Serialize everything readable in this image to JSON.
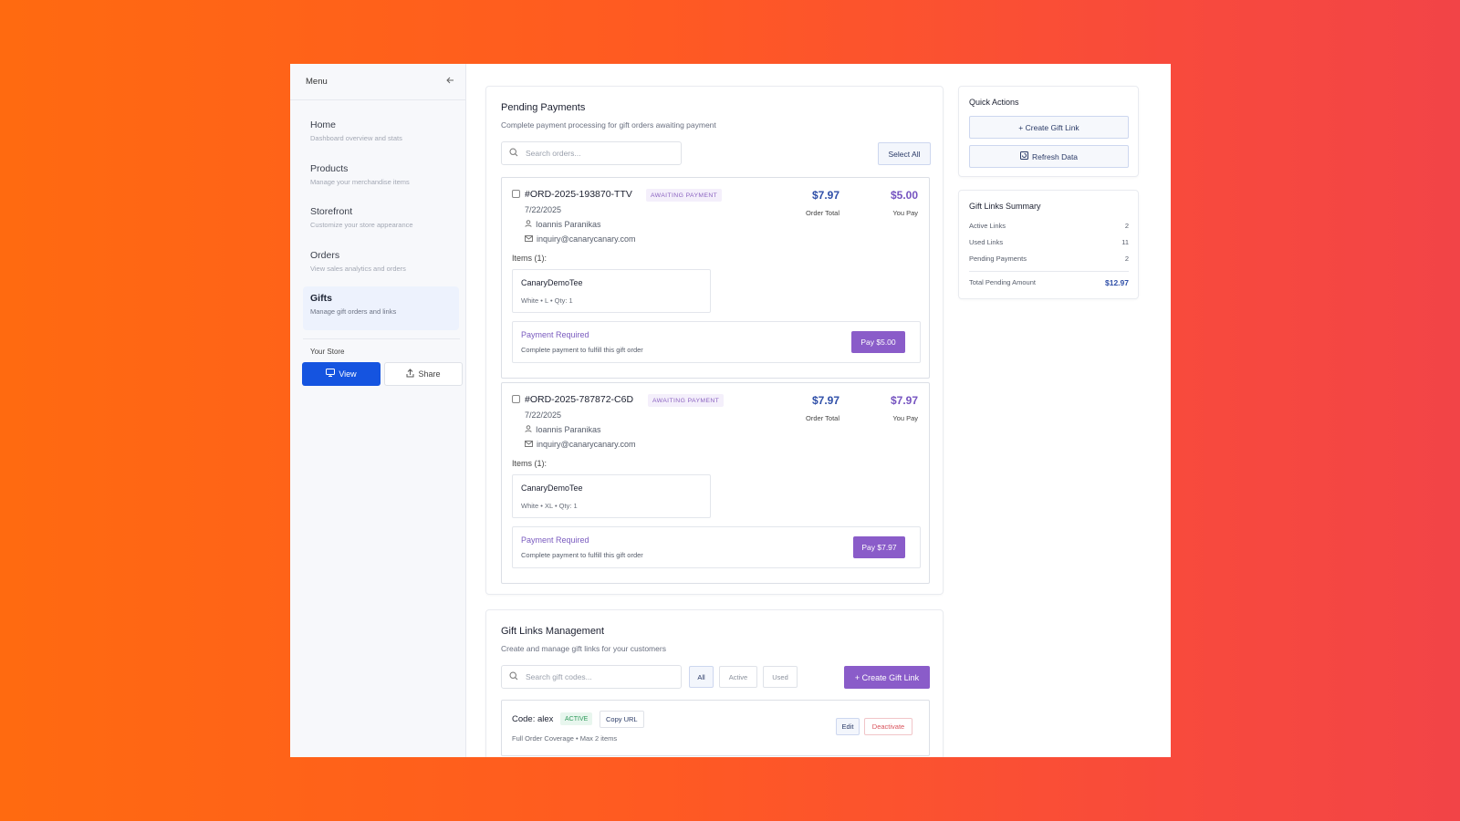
{
  "sidebar": {
    "title": "Menu",
    "items": [
      {
        "label": "Home",
        "desc": "Dashboard overview and stats"
      },
      {
        "label": "Products",
        "desc": "Manage your merchandise items"
      },
      {
        "label": "Storefront",
        "desc": "Customize your store appearance"
      },
      {
        "label": "Orders",
        "desc": "View sales analytics and orders"
      },
      {
        "label": "Gifts",
        "desc": "Manage gift orders and links"
      }
    ],
    "active_item": "Gifts",
    "store_label": "Your Store",
    "view_label": "View",
    "share_label": "Share"
  },
  "pending": {
    "title": "Pending Payments",
    "subtitle": "Complete payment processing for gift orders awaiting payment",
    "search_placeholder": "Search orders...",
    "select_all_label": "Select All",
    "orders": [
      {
        "id": "#ORD-2025-193870-TTV",
        "status": "AWAITING PAYMENT",
        "date": "7/22/2025",
        "customer": "Ioannis Paranikas",
        "email": "inquiry@canarycanary.com",
        "order_total": "$7.97",
        "order_total_label": "Order Total",
        "you_pay": "$5.00",
        "you_pay_label": "You Pay",
        "items_label": "Items (1):",
        "item_name": "CanaryDemoTee",
        "item_variant": "White • L • Qty: 1",
        "payment_title": "Payment Required",
        "payment_sub": "Complete payment to fulfill this gift order",
        "pay_button": "Pay $5.00"
      },
      {
        "id": "#ORD-2025-787872-C6D",
        "status": "AWAITING PAYMENT",
        "date": "7/22/2025",
        "customer": "Ioannis Paranikas",
        "email": "inquiry@canarycanary.com",
        "order_total": "$7.97",
        "order_total_label": "Order Total",
        "you_pay": "$7.97",
        "you_pay_label": "You Pay",
        "items_label": "Items (1):",
        "item_name": "CanaryDemoTee",
        "item_variant": "White • XL • Qty: 1",
        "payment_title": "Payment Required",
        "payment_sub": "Complete payment to fulfill this gift order",
        "pay_button": "Pay $7.97"
      }
    ]
  },
  "gift_links": {
    "title": "Gift Links Management",
    "subtitle": "Create and manage gift links for your customers",
    "search_placeholder": "Search gift codes...",
    "filters": [
      "All",
      "Active",
      "Used"
    ],
    "active_filter": "All",
    "create_label": "+ Create Gift Link",
    "rows": [
      {
        "code": "Code: alex",
        "status": "ACTIVE",
        "copy_label": "Copy URL",
        "desc": "Full Order Coverage • Max 2 items",
        "edit_label": "Edit",
        "deactivate_label": "Deactivate"
      }
    ]
  },
  "quick_actions": {
    "title": "Quick Actions",
    "create_label": "+ Create Gift Link",
    "refresh_label": "Refresh Data"
  },
  "summary": {
    "title": "Gift Links Summary",
    "rows": [
      {
        "label": "Active Links",
        "value": "2"
      },
      {
        "label": "Used Links",
        "value": "11"
      },
      {
        "label": "Pending Payments",
        "value": "2"
      }
    ],
    "total_label": "Total Pending Amount",
    "total_value": "$12.97"
  },
  "colors": {
    "primary_blue": "#1554e0",
    "purple": "#8a5cc9",
    "amount_blue": "#2f4fa8",
    "active_green": "#2f9a5a",
    "danger_red": "#d9545d"
  }
}
